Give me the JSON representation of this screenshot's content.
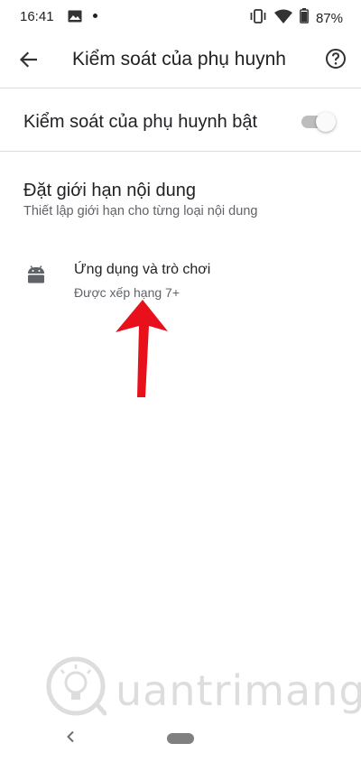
{
  "status_bar": {
    "time": "16:41",
    "battery_text": "87%",
    "icons": [
      "gallery-icon",
      "notification-dot",
      "vibrate-icon",
      "wifi-icon",
      "battery-icon"
    ]
  },
  "app_bar": {
    "title": "Kiểm soát của phụ huynh",
    "back_icon": "arrow-back-icon",
    "help_icon": "help-circle-icon"
  },
  "parental_switch": {
    "label": "Kiểm soát của phụ huynh bật",
    "state": "on"
  },
  "content_limits": {
    "title": "Đặt giới hạn nội dung",
    "subtitle": "Thiết lập giới hạn cho từng loại nội dung",
    "items": [
      {
        "icon": "android-icon",
        "title": "Ứng dụng và trò chơi",
        "rating": "Được xếp hạng 7+"
      }
    ]
  },
  "annotation": {
    "arrow_color": "#e8101b",
    "icon": "red-arrow-up"
  },
  "watermark": {
    "text": "uantrimang",
    "logo": "quantrimang-bulb-logo"
  },
  "nav_bar": {
    "back_icon": "nav-back-chevron-icon",
    "home_icon": "nav-home-pill-icon"
  }
}
